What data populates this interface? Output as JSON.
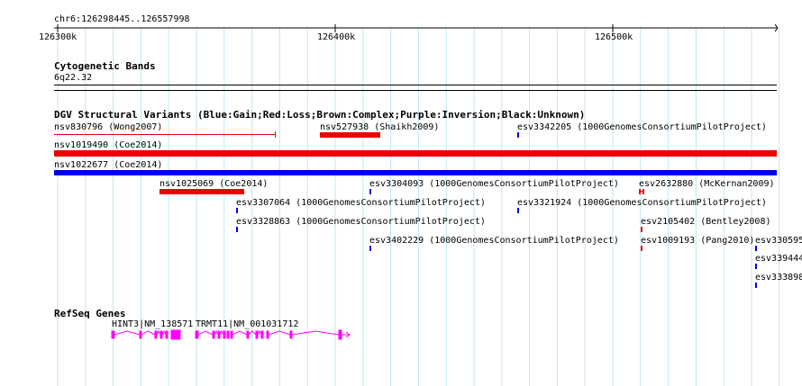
{
  "ruler": {
    "location": "chr6:126298445..126557998",
    "ticks": [
      "126300k",
      "126400k",
      "126500k"
    ]
  },
  "tracks": {
    "cytoband": {
      "title": "Cytogenetic Bands",
      "band": "6q22.32"
    },
    "dgv": {
      "title": "DGV Structural Variants (Blue:Gain;Red:Loss;Brown:Complex;Purple:Inversion;Black:Unknown)",
      "features": [
        {
          "label": "nsv830796 (Wong2007)"
        },
        {
          "label": "nsv527938 (Shaikh2009)"
        },
        {
          "label": "esv3342205 (1000GenomesConsortiumPilotProject)"
        },
        {
          "label": "nsv1019490 (Coe2014)"
        },
        {
          "label": "nsv1022677 (Coe2014)"
        },
        {
          "label": "nsv1025069 (Coe2014)"
        },
        {
          "label": "esv3304093 (1000GenomesConsortiumPilotProject)"
        },
        {
          "label": "esv2632880 (McKernan2009)"
        },
        {
          "label": "esv3307064 (1000GenomesConsortiumPilotProject)"
        },
        {
          "label": "esv3321924 (1000GenomesConsortiumPilotProject)"
        },
        {
          "label": "esv3328863 (1000GenomesConsortiumPilotProject)"
        },
        {
          "label": "esv2105402 (Bentley2008)"
        },
        {
          "label": "esv3402229 (1000GenomesConsortiumPilotProject)"
        },
        {
          "label": "esv1009193 (Pang2010)"
        },
        {
          "label": "esv330595"
        },
        {
          "label": "esv339444"
        },
        {
          "label": "esv333898"
        }
      ]
    },
    "refseq": {
      "title": "RefSeq Genes",
      "genes": [
        {
          "label": "HINT3|NM_138571"
        },
        {
          "label": "TRMT11|NM_001031712"
        }
      ]
    }
  },
  "colors": {
    "gain": "#0000ee",
    "loss": "#ee0000",
    "gene": "#ff00ff",
    "grid": "#bfe6f5"
  }
}
